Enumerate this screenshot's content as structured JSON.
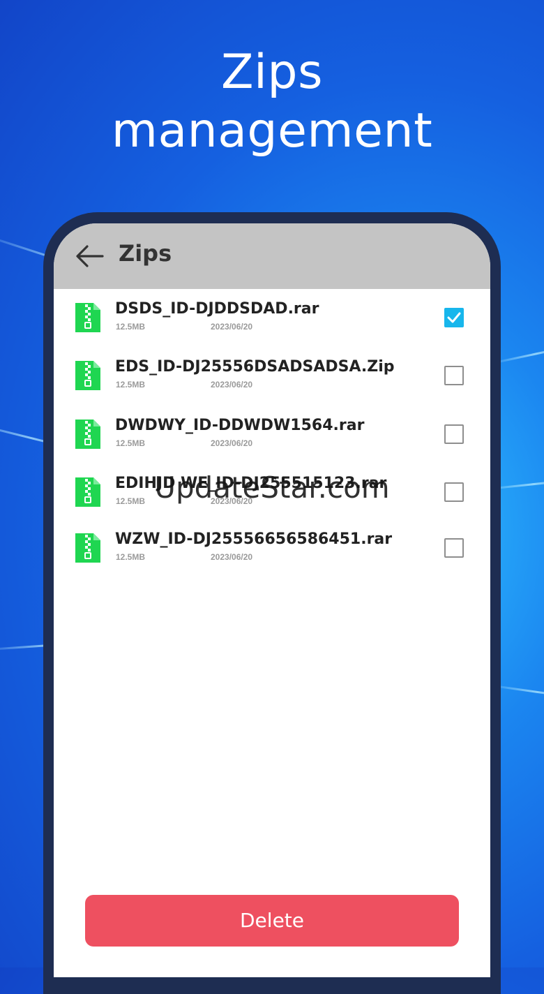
{
  "promo": {
    "title_line1": "Zips",
    "title_line2": "management"
  },
  "app_bar": {
    "title": "Zips",
    "back_icon": "arrow-left-icon"
  },
  "files": [
    {
      "name": "DSDS_ID-DJDDSDAD.rar",
      "size": "12.5MB",
      "date": "2023/06/20",
      "checked": true
    },
    {
      "name": "EDS_ID-DJ25556DSADSADSA.Zip",
      "size": "12.5MB",
      "date": "2023/06/20",
      "checked": false
    },
    {
      "name": "DWDWY_ID-DDWDW1564.rar",
      "size": "12.5MB",
      "date": "2023/06/20",
      "checked": false
    },
    {
      "name": "EDIHJD WE_ID-DJ255515123.rar",
      "size": "12.5MB",
      "date": "2023/06/20",
      "checked": false
    },
    {
      "name": "WZW_ID-DJ25556656586451.rar",
      "size": "12.5MB",
      "date": "2023/06/20",
      "checked": false
    }
  ],
  "file_icon": "zip-file-icon",
  "watermark": "UpdateStar.com",
  "delete_button": {
    "label": "Delete"
  },
  "colors": {
    "file_icon": "#1fd651",
    "checkbox_checked": "#17b6ec",
    "delete_button": "#ee5060",
    "app_bar": "#c4c4c4",
    "phone_frame": "#1e2d52"
  }
}
